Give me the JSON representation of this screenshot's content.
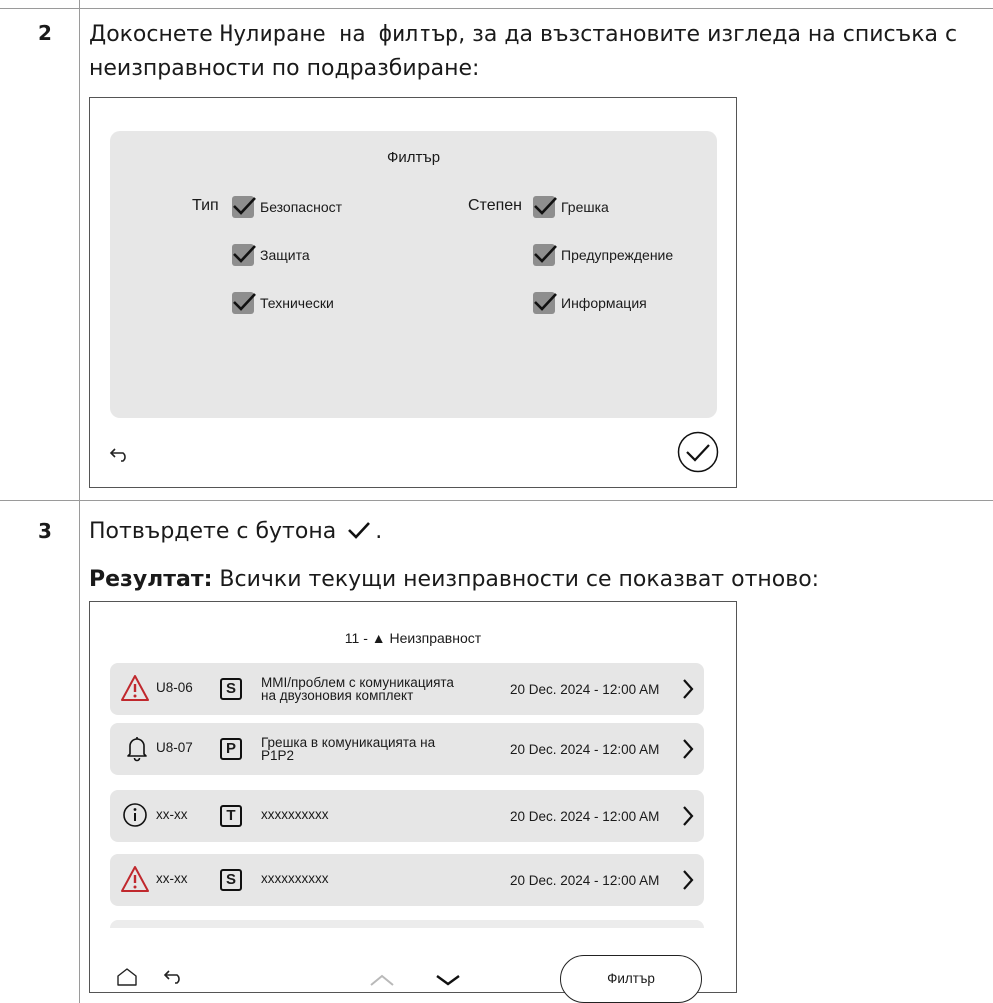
{
  "step2": {
    "number": "2",
    "text_before": "Докоснете ",
    "mono_term": "Нулиране на филтър",
    "text_after": ", за да възстановите изгледа на списъка с неизправности по подразбиране:"
  },
  "filter_screen": {
    "title": "Филтър",
    "type_label": "Тип",
    "severity_label": "Степен",
    "type_options": [
      {
        "label": "Безопасност",
        "checked": true
      },
      {
        "label": "Защита",
        "checked": true
      },
      {
        "label": "Технически",
        "checked": true
      }
    ],
    "severity_options": [
      {
        "label": "Грешка",
        "checked": true
      },
      {
        "label": "Предупреждение",
        "checked": true
      },
      {
        "label": "Информация",
        "checked": true
      }
    ],
    "back_icon": "back-arrow-icon",
    "confirm_icon": "confirm-check-circle-icon"
  },
  "step3": {
    "number": "3",
    "instruction_text": "Потвърдете с бутона",
    "instruction_icon": "check-icon",
    "instruction_end": ".",
    "result_label": "Резултат:",
    "result_text": " Всички текущи неизправности се показват отново:"
  },
  "fault_screen": {
    "title": "11 - ▲ Неизправност",
    "rows": [
      {
        "icon": "warning-triangle-icon",
        "code": "U8-06",
        "badge": "S",
        "desc_line1": "MMI/проблем с комуникацията",
        "desc_line2": "на двузоновия комплект",
        "date": "20 Dec. 2024 - 12:00 AM"
      },
      {
        "icon": "bell-icon",
        "code": "U8-07",
        "badge": "P",
        "desc_line1": "Грешка в комуникацията на",
        "desc_line2": "P1P2",
        "date": "20 Dec. 2024 - 12:00 AM"
      },
      {
        "icon": "info-circle-icon",
        "code": "xx-xx",
        "badge": "T",
        "desc_line1": "xxxxxxxxxx",
        "desc_line2": "",
        "date": "20 Dec. 2024 - 12:00 AM"
      },
      {
        "icon": "warning-triangle-icon",
        "code": "xx-xx",
        "badge": "S",
        "desc_line1": "xxxxxxxxxx",
        "desc_line2": "",
        "date": "20 Dec. 2024 - 12:00 AM"
      }
    ],
    "filter_button": "Филтър",
    "home_icon": "home-icon",
    "back_icon": "back-arrow-icon",
    "up_icon": "chevron-up-icon",
    "down_icon": "chevron-down-icon"
  },
  "colors": {
    "warning_red": "#c0282d",
    "panel_gray": "#e7e7e7",
    "checkbox_gray": "#8e8e8e"
  }
}
